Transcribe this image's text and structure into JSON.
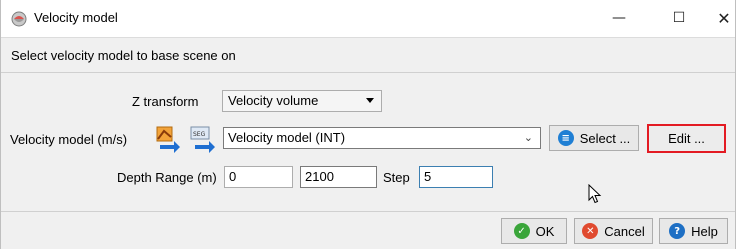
{
  "window": {
    "title": "Velocity model"
  },
  "window_controls": {
    "minimize": "—",
    "maximize": "☐",
    "close": "✕"
  },
  "header": {
    "text": "Select velocity model to base scene on"
  },
  "z_transform": {
    "label": "Z transform",
    "value": "Velocity volume"
  },
  "velocity_model": {
    "label": "Velocity model (m/s)",
    "value": "Velocity model (INT)",
    "select_label": "Select ...",
    "edit_label": "Edit ..."
  },
  "depth_range": {
    "label": "Depth Range (m)",
    "start": "0",
    "end": "2100",
    "step_label": "Step",
    "step": "5"
  },
  "footer": {
    "ok_label": "OK",
    "cancel_label": "Cancel",
    "help_label": "Help"
  },
  "colors": {
    "edit_highlight": "#e31b23",
    "ok_green": "#3aa53a",
    "cancel_red": "#e04a2f",
    "help_blue": "#1e6fc4",
    "select_blue": "#1f7fd4"
  }
}
